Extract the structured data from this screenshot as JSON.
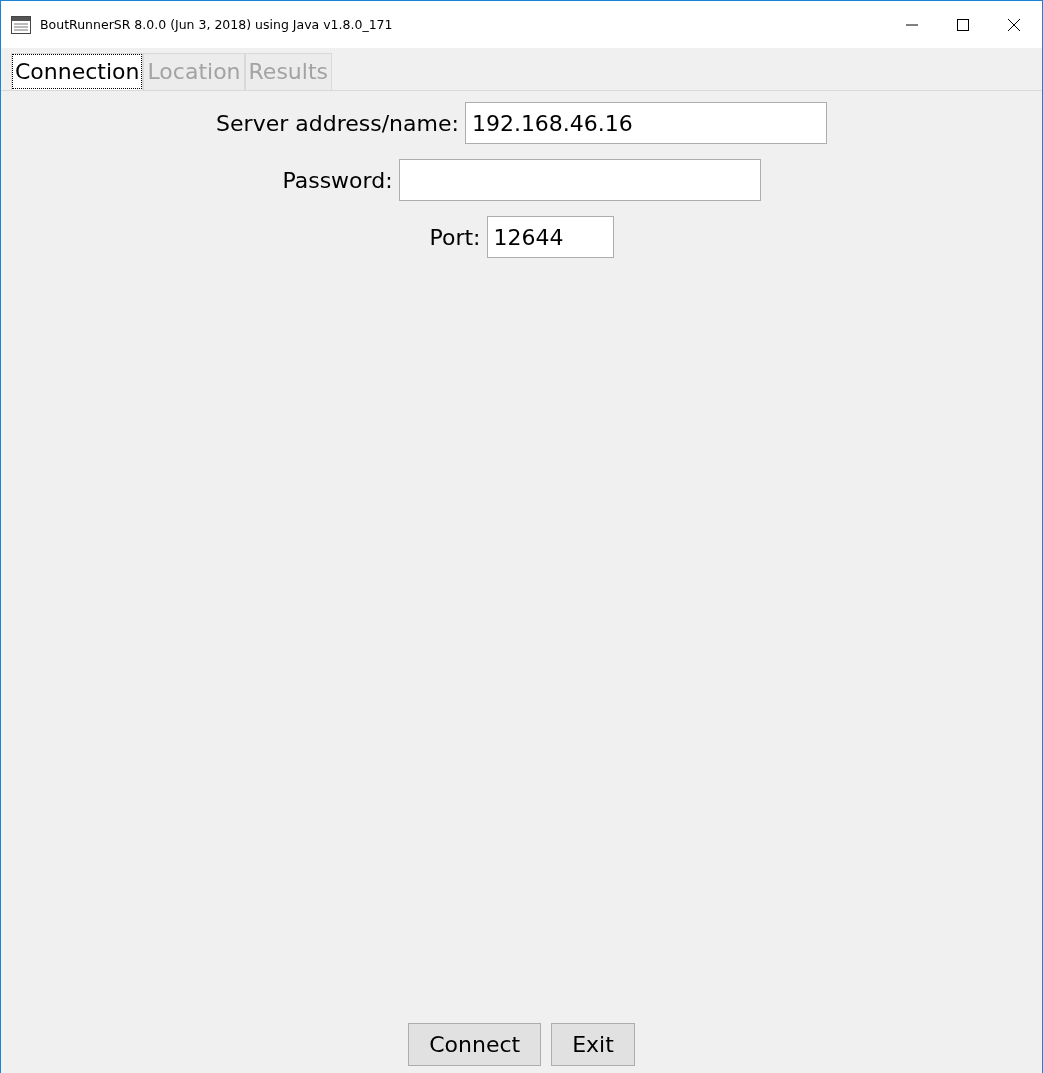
{
  "window": {
    "title": "BoutRunnerSR 8.0.0 (Jun 3, 2018) using Java v1.8.0_171"
  },
  "tabs": [
    {
      "label": "Connection",
      "selected": true,
      "disabled": false
    },
    {
      "label": "Location",
      "selected": false,
      "disabled": true
    },
    {
      "label": "Results",
      "selected": false,
      "disabled": true
    }
  ],
  "fields": [
    {
      "label": "Server address/name:",
      "value": "192.168.46.16"
    },
    {
      "label": "Password:"
    },
    {
      "label": "Port:",
      "value": "12644"
    }
  ],
  "buttons": [
    "Connect",
    "Exit"
  ]
}
